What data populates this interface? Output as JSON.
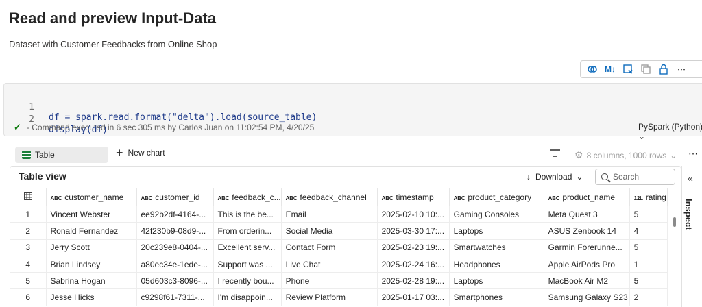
{
  "page": {
    "title": "Read and preview Input-Data",
    "subtitle": "Dataset with Customer Feedbacks from Online Shop"
  },
  "cell_toolbar": {
    "buttons": [
      "copilot-icon",
      "markdown-icon",
      "freeze-icon",
      "copy-icon",
      "lock-icon",
      "more-icon"
    ],
    "markdown_label": "M↓"
  },
  "code_cell": {
    "lines": [
      {
        "number": "1",
        "text": "df = spark.read.format(\"delta\").load(source_table)"
      },
      {
        "number": "2",
        "text": "display(df)"
      }
    ],
    "status": "- Command executed in 6 sec 305 ms by Carlos Juan on 11:02:54 PM, 4/20/25",
    "language": "PySpark (Python)"
  },
  "output_toolbar": {
    "table_tab": "Table",
    "new_chart": "New chart",
    "column_info": "8 columns, 1000 rows"
  },
  "table_view": {
    "title": "Table view",
    "download": "Download",
    "search_placeholder": "Search",
    "columns": [
      {
        "type": "ABC",
        "name": "customer_name"
      },
      {
        "type": "ABC",
        "name": "customer_id"
      },
      {
        "type": "ABC",
        "name": "feedback_c..."
      },
      {
        "type": "ABC",
        "name": "feedback_channel"
      },
      {
        "type": "ABC",
        "name": "timestamp"
      },
      {
        "type": "ABC",
        "name": "product_category"
      },
      {
        "type": "ABC",
        "name": "product_name"
      },
      {
        "type": "12L",
        "name": "rating"
      }
    ],
    "rows": [
      [
        "1",
        "Vincent Webster",
        "ee92b2df-4164-...",
        "This is the be...",
        "Email",
        "2025-02-10 10:...",
        "Gaming Consoles",
        "Meta Quest 3",
        "5"
      ],
      [
        "2",
        "Ronald Fernandez",
        "42f230b9-08d9-...",
        "From orderin...",
        "Social Media",
        "2025-03-30 17:...",
        "Laptops",
        "ASUS Zenbook 14",
        "4"
      ],
      [
        "3",
        "Jerry Scott",
        "20c239e8-0404-...",
        "Excellent serv...",
        "Contact Form",
        "2025-02-23 19:...",
        "Smartwatches",
        "Garmin Forerunne...",
        "5"
      ],
      [
        "4",
        "Brian Lindsey",
        "a80ec34e-1ede-...",
        "Support was ...",
        "Live Chat",
        "2025-02-24 16:...",
        "Headphones",
        "Apple AirPods Pro",
        "1"
      ],
      [
        "5",
        "Sabrina Hogan",
        "05d603c3-8096-...",
        "I recently bou...",
        "Phone",
        "2025-02-28 19:...",
        "Laptops",
        "MacBook Air M2",
        "5"
      ],
      [
        "6",
        "Jesse Hicks",
        "c9298f61-7311-...",
        "I'm disappoin...",
        "Review Platform",
        "2025-01-17 03:...",
        "Smartphones",
        "Samsung Galaxy S23",
        "2"
      ]
    ]
  },
  "inspect_panel": {
    "label": "Inspect"
  }
}
